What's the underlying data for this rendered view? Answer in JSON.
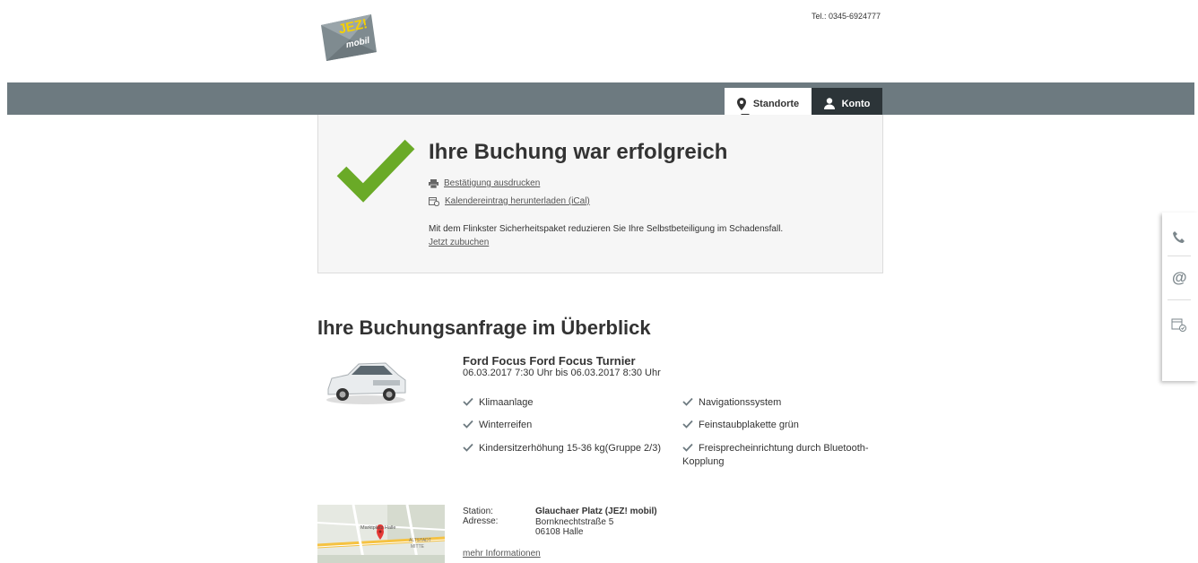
{
  "header": {
    "logo_text_top": "JEZ!",
    "logo_text_bottom": "mobil",
    "phone": "Tel.: 0345-6924777"
  },
  "nav": {
    "standorte_label": "Standorte",
    "konto_label": "Konto"
  },
  "success": {
    "title": "Ihre Buchung war erfolgreich",
    "print_link": "Bestätigung ausdrucken",
    "ical_link": "Kalendereintrag herunterladen (iCal)",
    "info_text": "Mit dem Flinkster Sicherheitspaket reduzieren Sie Ihre Selbstbeteiligung im Schadensfall.",
    "book_link": "Jetzt zubuchen",
    "accent_color": "#6aaa27"
  },
  "side_panel": {
    "icons": [
      "phone-icon",
      "at-icon",
      "calendar-icon"
    ]
  },
  "overview": {
    "title": "Ihre Buchungsanfrage im Überblick",
    "car_name": "Ford Focus Ford Focus Turnier",
    "dates": "06.03.2017 7:30 Uhr bis 06.03.2017 8:30 Uhr",
    "features": [
      "Klimaanlage",
      "Navigationssystem",
      "Winterreifen",
      "Feinstaubplakette grün",
      "Kindersitzerhöhung 15-36 kg(Gruppe 2/3)",
      "Freisprecheinrichtung durch Bluetooth-Kopplung"
    ]
  },
  "station": {
    "station_label": "Station:",
    "address_label": "Adresse:",
    "name": "Glauchaer Platz (JEZ! mobil)",
    "street": "Bornknechtstraße 5",
    "city": "06108 Halle",
    "more_link": "mehr Informationen",
    "map_labels": [
      "Marktplatz Halle",
      "ALTSTADT",
      "MITTE"
    ]
  }
}
